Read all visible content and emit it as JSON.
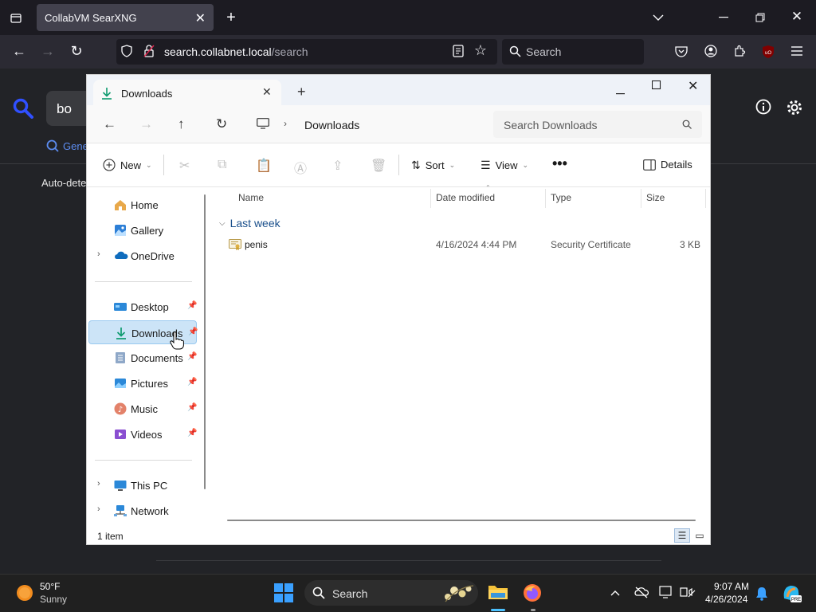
{
  "browser": {
    "tab_title": "CollabVM SearXNG",
    "url_domain": "search.collabnet.local",
    "url_path": "/search",
    "search_placeholder": "Search"
  },
  "page_behind": {
    "query": "bo",
    "tab_label": "Gene",
    "auto_detect": "Auto-dete"
  },
  "explorer": {
    "tab_title": "Downloads",
    "breadcrumb": "Downloads",
    "search_placeholder": "Search Downloads",
    "toolbar": {
      "new_label": "New",
      "sort_label": "Sort",
      "view_label": "View",
      "details_label": "Details"
    },
    "nav": {
      "home": "Home",
      "gallery": "Gallery",
      "onedrive": "OneDrive",
      "desktop": "Desktop",
      "downloads": "Downloads",
      "documents": "Documents",
      "pictures": "Pictures",
      "music": "Music",
      "videos": "Videos",
      "thispc": "This PC",
      "network": "Network"
    },
    "columns": {
      "name": "Name",
      "date": "Date modified",
      "type": "Type",
      "size": "Size"
    },
    "group_label": "Last week",
    "file": {
      "name": "penis",
      "date": "4/16/2024 4:44 PM",
      "type": "Security Certificate",
      "size": "3 KB"
    },
    "status": "1 item"
  },
  "taskbar": {
    "weather_temp": "50°F",
    "weather_cond": "Sunny",
    "search_label": "Search",
    "time": "9:07 AM",
    "date": "4/26/2024"
  },
  "colors": {
    "accent": "#0067c0",
    "nav_selected": "#cce4f7",
    "firefox_bg": "#1c1b22"
  }
}
